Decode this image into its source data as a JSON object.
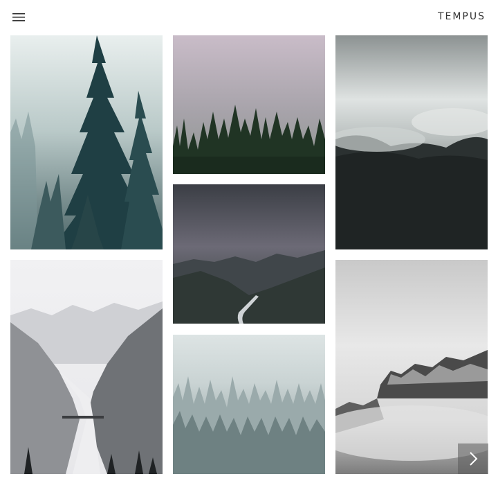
{
  "header": {
    "brand": "TEMPUS",
    "menu_icon": "hamburger-icon"
  },
  "gallery": {
    "tiles": [
      {
        "name": "misty-pine-forest",
        "column": 1,
        "row": 1
      },
      {
        "name": "foggy-treeline",
        "column": 2,
        "row": 1
      },
      {
        "name": "clouded-mountain-forest",
        "column": 3,
        "row": 1
      },
      {
        "name": "stormy-valley-road",
        "column": 2,
        "row": 2
      },
      {
        "name": "snowy-mountain-valley",
        "column": 1,
        "row": 2
      },
      {
        "name": "snow-covered-forest",
        "column": 2,
        "row": 3
      },
      {
        "name": "snowy-peak-in-clouds",
        "column": 3,
        "row": 2
      }
    ],
    "next_icon": "chevron-right-icon"
  },
  "colors": {
    "background": "#ffffff",
    "brand_text": "#333333"
  }
}
